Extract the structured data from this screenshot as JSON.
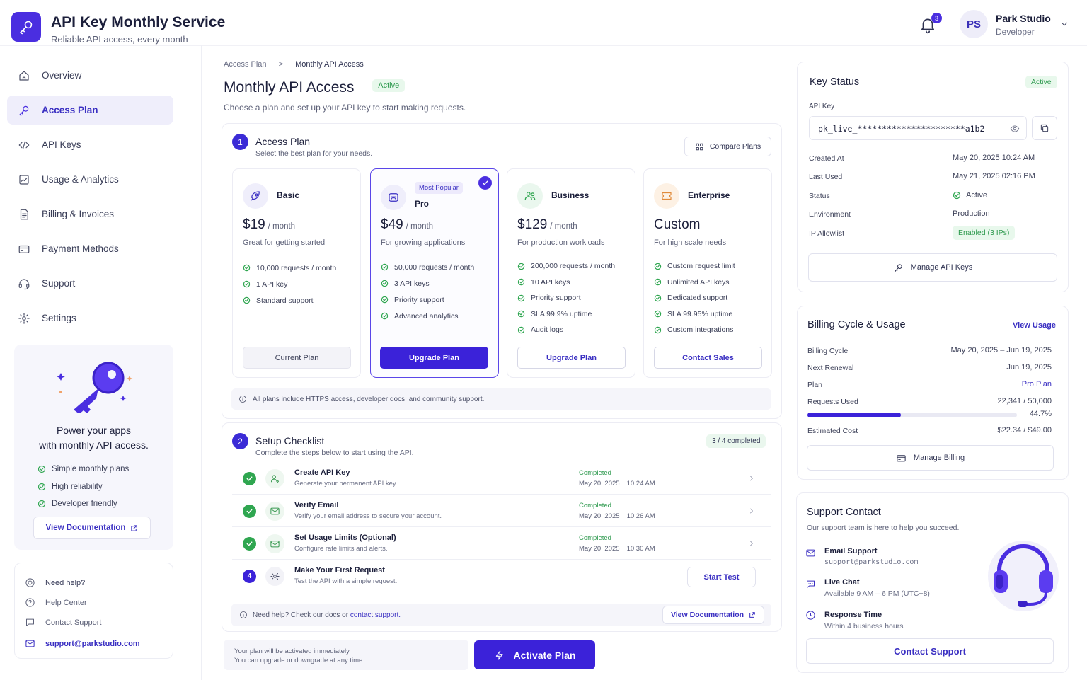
{
  "brand": {
    "title": "API Key Monthly Service",
    "subtitle": "Reliable API access, every month"
  },
  "header": {
    "notification_count": "3",
    "user_initials": "PS",
    "user_name": "Park Studio",
    "user_role": "Developer"
  },
  "sidebar": {
    "items": [
      {
        "label": "Overview",
        "icon": "home-icon"
      },
      {
        "label": "Access Plan",
        "icon": "key-icon",
        "active": true
      },
      {
        "label": "API Keys",
        "icon": "code-icon"
      },
      {
        "label": "Usage & Analytics",
        "icon": "chart-icon"
      },
      {
        "label": "Billing & Invoices",
        "icon": "document-icon"
      },
      {
        "label": "Payment Methods",
        "icon": "credit-card-icon"
      },
      {
        "label": "Support",
        "icon": "headset-icon"
      },
      {
        "label": "Settings",
        "icon": "gear-icon"
      }
    ],
    "promo": {
      "title_line1": "Power your apps",
      "title_line2": "with monthly API access.",
      "features": [
        "Simple monthly plans",
        "High reliability",
        "Developer friendly"
      ],
      "button": "View Documentation"
    },
    "help": {
      "title": "Need help?",
      "help_center": "Help Center",
      "contact_support": "Contact Support",
      "email": "support@parkstudio.com"
    }
  },
  "breadcrumb": {
    "parent": "Access Plan",
    "current": "Monthly API Access"
  },
  "page": {
    "title": "Monthly API Access",
    "status": "Active",
    "subtitle": "Choose a plan and set up your API key to start making requests."
  },
  "access_plan": {
    "step": "1",
    "title": "Access Plan",
    "subtitle": "Select the best plan for your needs.",
    "compare_button": "Compare Plans",
    "plans": [
      {
        "name": "Basic",
        "price": "$19",
        "per": "/ month",
        "desc": "Great for getting started",
        "features": [
          "10,000 requests / month",
          "1 API key",
          "Standard support"
        ],
        "button": "Current Plan"
      },
      {
        "name": "Pro",
        "badge": "Most Popular",
        "price": "$49",
        "per": "/ month",
        "desc": "For growing applications",
        "features": [
          "50,000 requests / month",
          "3 API keys",
          "Priority support",
          "Advanced analytics"
        ],
        "button": "Upgrade Plan"
      },
      {
        "name": "Business",
        "price": "$129",
        "per": "/ month",
        "desc": "For production workloads",
        "features": [
          "200,000 requests / month",
          "10 API keys",
          "Priority support",
          "SLA 99.9% uptime",
          "Audit logs"
        ],
        "button": "Upgrade Plan"
      },
      {
        "name": "Enterprise",
        "price": "Custom",
        "per": "",
        "desc": "For high scale needs",
        "features": [
          "Custom request limit",
          "Unlimited API keys",
          "Dedicated support",
          "SLA 99.95% uptime",
          "Custom integrations"
        ],
        "button": "Contact Sales"
      }
    ],
    "note": "All plans include HTTPS access, developer docs, and community support."
  },
  "checklist": {
    "step": "2",
    "title": "Setup Checklist",
    "subtitle": "Complete the steps below to start using the API.",
    "progress": "3 / 4 completed",
    "items": [
      {
        "title": "Create API Key",
        "desc": "Generate your permanent API key.",
        "status": "Completed",
        "date": "May 20, 2025",
        "time": "10:24 AM"
      },
      {
        "title": "Verify Email",
        "desc": "Verify your email address to secure your account.",
        "status": "Completed",
        "date": "May 20, 2025",
        "time": "10:26 AM"
      },
      {
        "title": "Set Usage Limits (Optional)",
        "desc": "Configure rate limits and alerts.",
        "status": "Completed",
        "date": "May 20, 2025",
        "time": "10:30 AM"
      },
      {
        "title": "Make Your First Request",
        "desc": "Test the API with a simple request.",
        "step": "4",
        "button": "Start Test"
      }
    ],
    "help_text": "Need help? Check our docs or",
    "help_link": "contact support.",
    "doc_button": "View Documentation"
  },
  "footer": {
    "line1": "Your plan will be activated immediately.",
    "line2": "You can upgrade or downgrade at any time.",
    "activate": "Activate Plan"
  },
  "key_status": {
    "title": "Key Status",
    "status": "Active",
    "key_label": "API Key",
    "key_value": "pk_live_**********************a1b2",
    "rows": [
      {
        "k": "Created At",
        "v": "May 20, 2025  10:24 AM"
      },
      {
        "k": "Last Used",
        "v": "May 21, 2025  02:16 PM"
      },
      {
        "k": "Status",
        "v": "Active"
      },
      {
        "k": "Environment",
        "v": "Production"
      },
      {
        "k": "IP Allowlist",
        "v": "Enabled (3 IPs)"
      }
    ],
    "manage_button": "Manage API Keys"
  },
  "billing": {
    "title": "Billing Cycle & Usage",
    "link": "View Usage",
    "rows": [
      {
        "k": "Billing Cycle",
        "v": "May 20, 2025 – Jun 19, 2025"
      },
      {
        "k": "Next Renewal",
        "v": "Jun 19, 2025"
      },
      {
        "k": "Plan",
        "v": "Pro Plan"
      },
      {
        "k": "Requests Used",
        "v": "22,341 / 50,000"
      }
    ],
    "usage_percent": "44.7%",
    "usage_fraction": 0.447,
    "cost_label": "Estimated Cost",
    "cost_value": "$22.34 / $49.00",
    "manage_button": "Manage Billing"
  },
  "support": {
    "title": "Support Contact",
    "subtitle": "Our support team is here to help you succeed.",
    "email_label": "Email Support",
    "email_value": "support@parkstudio.com",
    "chat_label": "Live Chat",
    "chat_value": "Available 9 AM – 6 PM (UTC+8)",
    "response_label": "Response Time",
    "response_value": "Within 4 business hours",
    "button": "Contact Support"
  },
  "colors": {
    "primary": "#4a2ee0",
    "success": "#2fa650",
    "text": "#1c1f3b"
  }
}
